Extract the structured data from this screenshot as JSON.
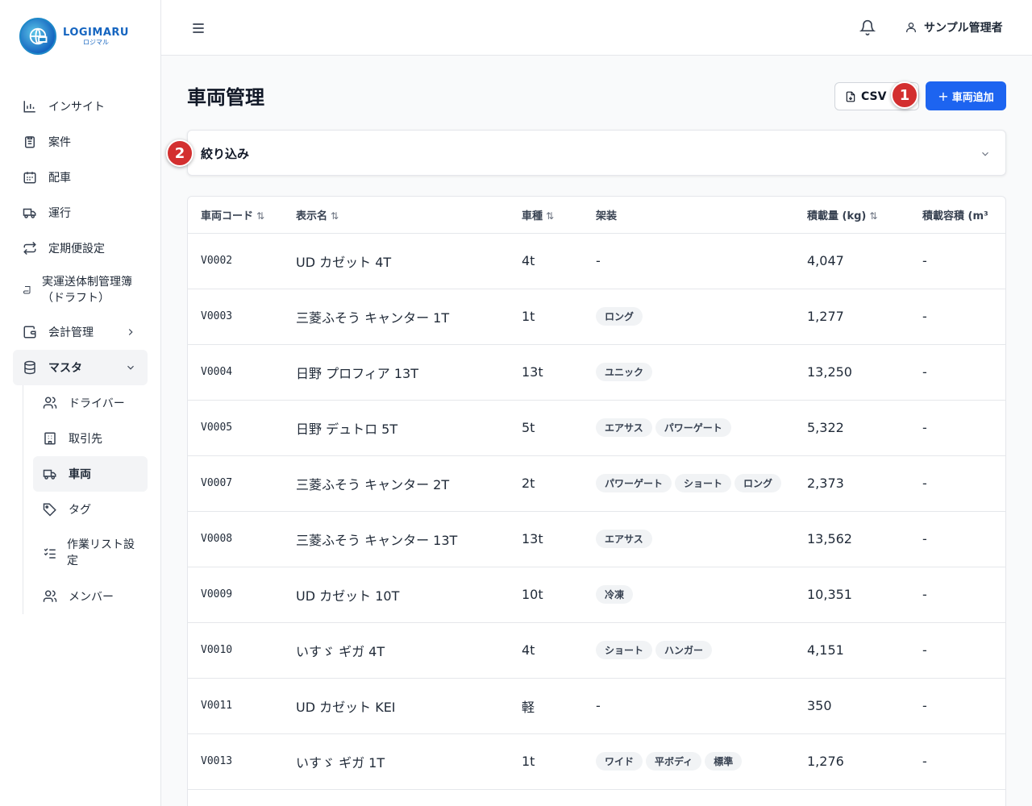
{
  "app": {
    "logo_title": "LOGIMARU",
    "logo_sub": "ロジマル"
  },
  "header": {
    "user_name": "サンプル管理者"
  },
  "sidebar": {
    "items": [
      {
        "label": "インサイト",
        "icon": "bar-chart-icon"
      },
      {
        "label": "案件",
        "icon": "clipboard-icon"
      },
      {
        "label": "配車",
        "icon": "calendar-icon"
      },
      {
        "label": "運行",
        "icon": "truck-icon"
      },
      {
        "label": "定期便設定",
        "icon": "repeat-icon"
      },
      {
        "label": "実運送体制管理簿（ドラフト）",
        "icon": "scroll-icon"
      },
      {
        "label": "会計管理",
        "icon": "wallet-icon"
      },
      {
        "label": "マスタ",
        "icon": "database-icon"
      }
    ],
    "sub_items": [
      {
        "label": "ドライバー",
        "icon": "users-icon"
      },
      {
        "label": "取引先",
        "icon": "building-icon"
      },
      {
        "label": "車両",
        "icon": "truck-icon"
      },
      {
        "label": "タグ",
        "icon": "tag-icon"
      },
      {
        "label": "作業リスト設定",
        "icon": "list-checks-icon"
      },
      {
        "label": "メンバー",
        "icon": "users-icon"
      }
    ]
  },
  "main": {
    "title": "車両管理",
    "csv_button": "CSV",
    "add_button": "車両追加",
    "filter_label": "絞り込み",
    "markers": [
      "1",
      "2"
    ]
  },
  "table": {
    "columns": [
      "車両コード",
      "表示名",
      "車種",
      "架装",
      "積載量 (kg)",
      "積載容積 (m³"
    ],
    "rows": [
      {
        "code": "V0002",
        "name": "UD カゼット 4T",
        "type": "4t",
        "body": [],
        "body_text": "-",
        "load": "4,047",
        "volume": "-"
      },
      {
        "code": "V0003",
        "name": "三菱ふそう キャンター 1T",
        "type": "1t",
        "body": [
          "ロング"
        ],
        "body_text": "",
        "load": "1,277",
        "volume": "-"
      },
      {
        "code": "V0004",
        "name": "日野 プロフィア 13T",
        "type": "13t",
        "body": [
          "ユニック"
        ],
        "body_text": "",
        "load": "13,250",
        "volume": "-"
      },
      {
        "code": "V0005",
        "name": "日野 デュトロ 5T",
        "type": "5t",
        "body": [
          "エアサス",
          "パワーゲート"
        ],
        "body_text": "",
        "load": "5,322",
        "volume": "-"
      },
      {
        "code": "V0007",
        "name": "三菱ふそう キャンター 2T",
        "type": "2t",
        "body": [
          "パワーゲート",
          "ショート",
          "ロング"
        ],
        "body_text": "",
        "load": "2,373",
        "volume": "-"
      },
      {
        "code": "V0008",
        "name": "三菱ふそう キャンター 13T",
        "type": "13t",
        "body": [
          "エアサス"
        ],
        "body_text": "",
        "load": "13,562",
        "volume": "-"
      },
      {
        "code": "V0009",
        "name": "UD カゼット 10T",
        "type": "10t",
        "body": [
          "冷凍"
        ],
        "body_text": "",
        "load": "10,351",
        "volume": "-"
      },
      {
        "code": "V0010",
        "name": "いすゞ ギガ 4T",
        "type": "4t",
        "body": [
          "ショート",
          "ハンガー"
        ],
        "body_text": "",
        "load": "4,151",
        "volume": "-"
      },
      {
        "code": "V0011",
        "name": "UD カゼット KEI",
        "type": "軽",
        "body": [],
        "body_text": "-",
        "load": "350",
        "volume": "-"
      },
      {
        "code": "V0013",
        "name": "いすゞ ギガ 1T",
        "type": "1t",
        "body": [
          "ワイド",
          "平ボディ",
          "標準"
        ],
        "body_text": "",
        "load": "1,276",
        "volume": "-"
      }
    ]
  },
  "colors": {
    "primary": "#1d64f0",
    "marker": "#d32f2f"
  }
}
